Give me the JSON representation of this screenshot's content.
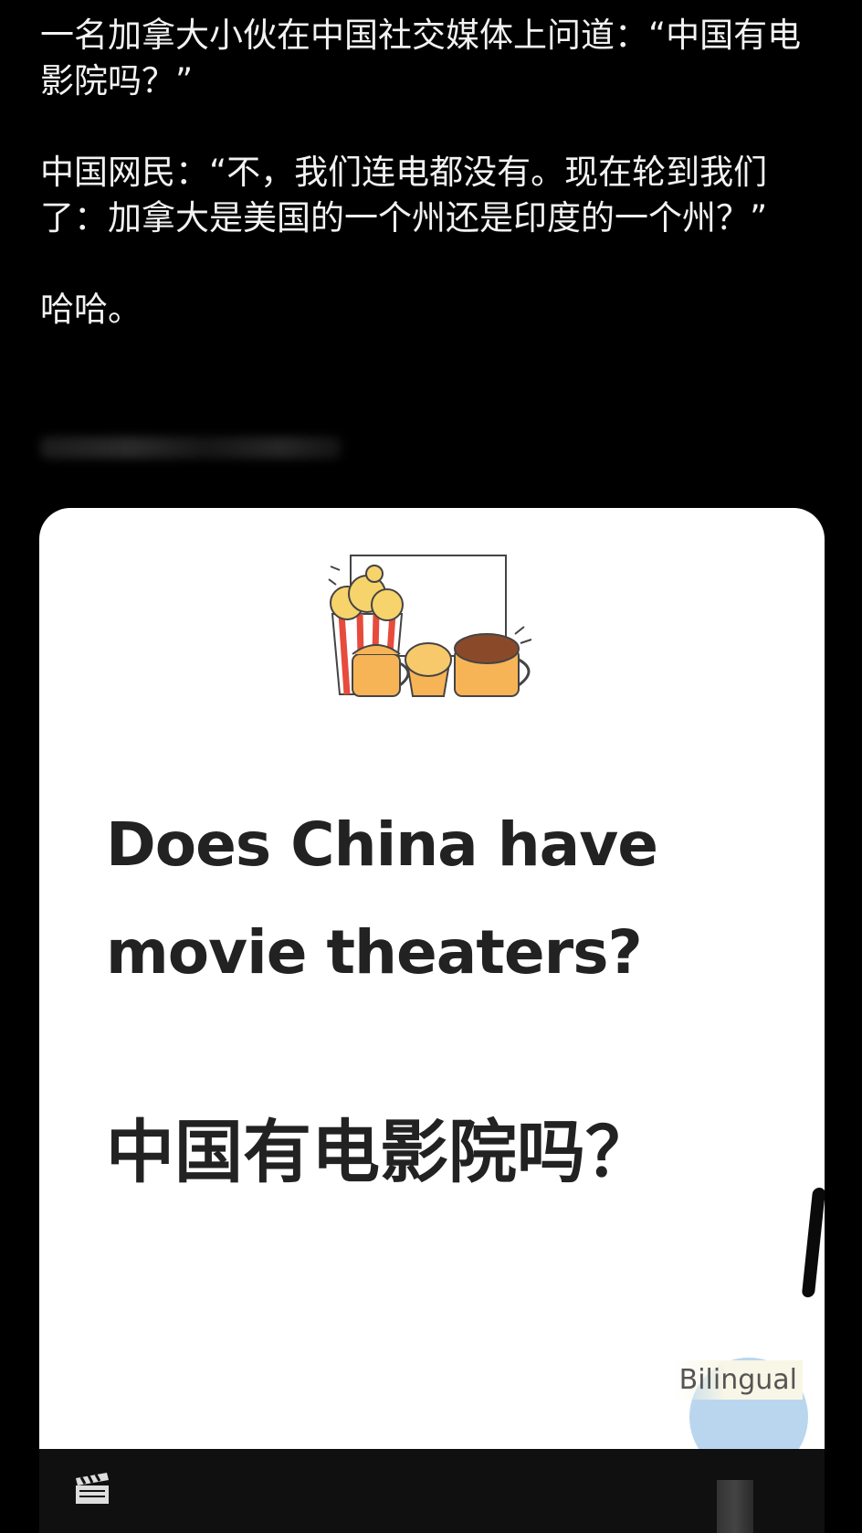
{
  "post": {
    "paragraph1": "一名加拿大小伙在中国社交媒体上问道：“中国有电影院吗？”",
    "paragraph2": "中国网民：“不，我们连电都没有。现在轮到我们了：加拿大是美国的一个州还是印度的一个州？”",
    "paragraph3": "哈哈。"
  },
  "card": {
    "title_en": "Does China have movie theaters?",
    "title_zh": "中国有电影院吗？",
    "language_badge": "Bilingual",
    "illustration_icon": "popcorn-and-snacks-icon"
  },
  "bottom_bar": {
    "icon": "clapperboard-icon"
  },
  "colors": {
    "background": "#000000",
    "card": "#ffffff",
    "heading_text": "#222222",
    "snack_orange": "#f6b457"
  }
}
